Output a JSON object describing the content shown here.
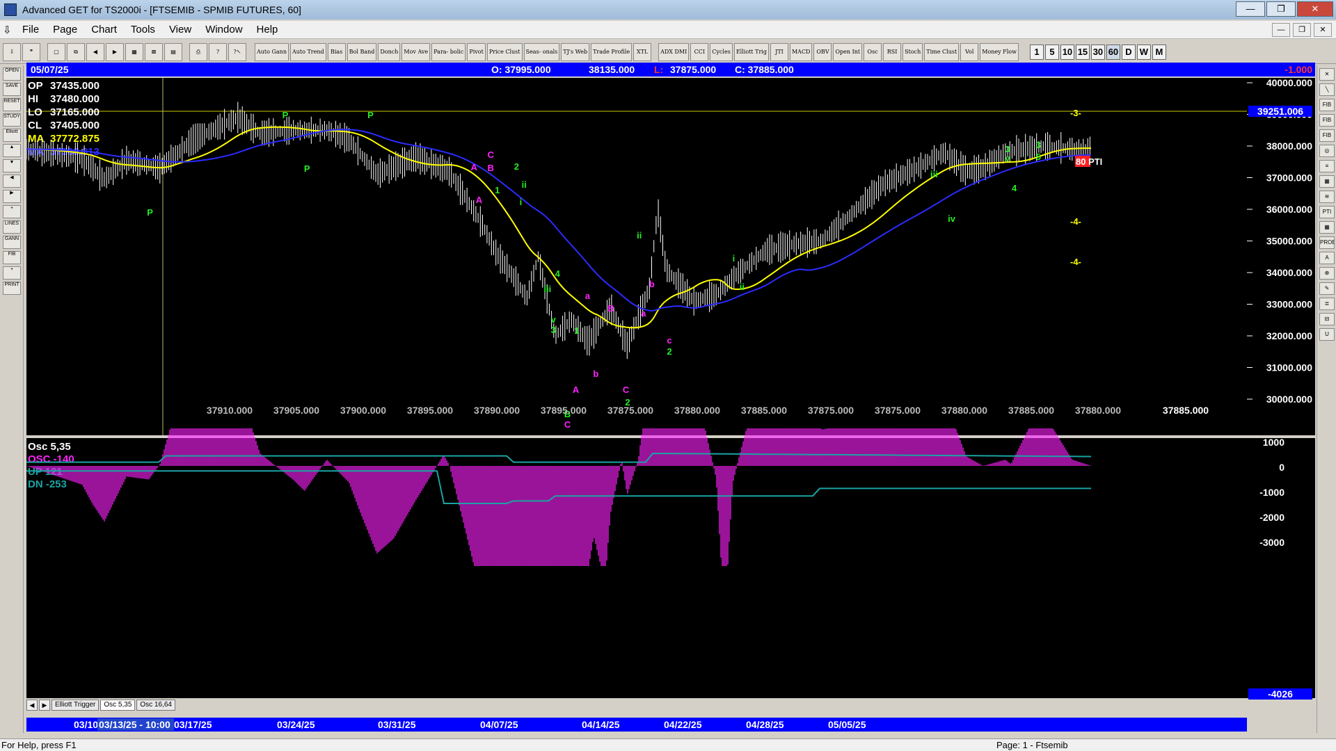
{
  "window": {
    "title": "Advanced GET for TS2000i - [FTSEMIB - SPMIB FUTURES, 60]",
    "controls": [
      "—",
      "❐",
      "✕"
    ]
  },
  "menu": [
    "File",
    "Page",
    "Chart",
    "Tools",
    "View",
    "Window",
    "Help"
  ],
  "toolbar": {
    "studies": [
      "Auto Gann",
      "Auto Trend",
      "Bias",
      "Bol Band",
      "Donch",
      "Mov Ave",
      "Para- bolic",
      "Pivot",
      "Price Clust",
      "Seas- onals",
      "TJ's Web",
      "Trade Profile",
      "XTL",
      "ADX DMI",
      "CCI",
      "Cycles",
      "Elliott Trig",
      "JTI",
      "MACD",
      "OBV",
      "Open Int",
      "Osc",
      "RSI",
      "Stoch",
      "Time Clust",
      "Vol",
      "Money Flow"
    ],
    "timeframes": [
      "1",
      "5",
      "10",
      "15",
      "30",
      "60",
      "D",
      "W",
      "M"
    ],
    "active_timeframe": "60"
  },
  "header": {
    "date": "05/07/25",
    "open": "O: 37995.000",
    "high": "38135.000",
    "low_label": "L:",
    "low": "37875.000",
    "close": "C: 37885.000",
    "change": "-1.000"
  },
  "legend": [
    {
      "label": "OP",
      "value": "37435.000",
      "color": "#ffffff"
    },
    {
      "label": "HI",
      "value": "37480.000",
      "color": "#ffffff"
    },
    {
      "label": "LO",
      "value": "37165.000",
      "color": "#ffffff"
    },
    {
      "label": "CL",
      "value": "37405.000",
      "color": "#ffffff"
    },
    {
      "label": "MA",
      "value": "37772.875",
      "color": "#ffff00"
    },
    {
      "label": "MA",
      "value": "37563.313",
      "color": "#2b2bff"
    }
  ],
  "price_axis": {
    "ticks": [
      "40000.000",
      "39000.000",
      "38000.000",
      "37000.000",
      "36000.000",
      "35000.000",
      "34000.000",
      "33000.000",
      "32000.000",
      "31000.000",
      "30000.000"
    ],
    "marker": "39251.006"
  },
  "bottom_values": [
    "37910.000",
    "37905.000",
    "37900.000",
    "37895.000",
    "37890.000",
    "37895.000",
    "37875.000",
    "37880.000",
    "37885.000",
    "37875.000",
    "37875.000",
    "37880.000",
    "37885.000",
    "37880.000",
    "37885.000"
  ],
  "annotations": {
    "pti": "80 PTI",
    "targets": [
      "-3-",
      "-4-",
      "-4-"
    ]
  },
  "oscillator": {
    "title": "Osc 5,35",
    "osc": "OSC -140",
    "up": "UP  121",
    "dn": "DN  -253",
    "ticks": [
      "1000",
      "0",
      "-1000",
      "-2000",
      "-3000"
    ],
    "value": "-4026"
  },
  "tabs": [
    "Elliott Trigger",
    "Osc 5,35",
    "Osc 16,64"
  ],
  "active_tab": "Osc 5,35",
  "date_axis": [
    "03/10",
    "03/13/25 - 10:00",
    "03/17/25",
    "03/24/25",
    "03/31/25",
    "04/07/25",
    "04/14/25",
    "04/22/25",
    "04/28/25",
    "05/05/25"
  ],
  "status": {
    "left": "For Help, press F1",
    "right": "Page: 1 - Ftsemib"
  },
  "left_tools": [
    "OPEN",
    "SAVE",
    "RESET",
    "STUDY",
    "Elliott",
    "▲",
    "▼",
    "◀",
    "▶",
    "+",
    "LINES",
    "GANN",
    "FIB",
    "+",
    "PRINT"
  ],
  "right_tools": [
    "✕",
    "╲",
    "FIB RET",
    "FIB EXT",
    "FIB TIME",
    "◎",
    "≡",
    "▦",
    "≋",
    "PTI",
    "▦",
    "PROB",
    "A",
    "⊕",
    "✎",
    "≣",
    "⊟",
    "U"
  ],
  "colors": {
    "background": "#000000",
    "yellow": "#ffff00",
    "blue": "#2b2bff",
    "green": "#22ee22",
    "magenta": "#ff22ff",
    "teal": "#1aa3a3",
    "header": "#0000ff"
  }
}
